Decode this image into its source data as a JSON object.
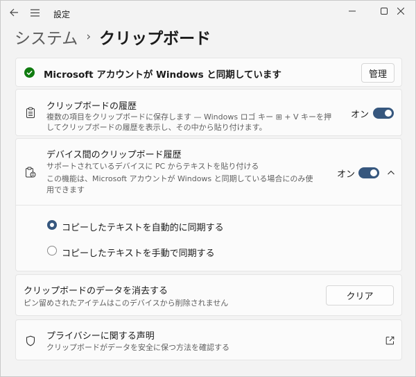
{
  "app": {
    "title": "設定",
    "back_icon": "arrow-left-icon",
    "menu_icon": "hamburger-icon"
  },
  "window_controls": {
    "minimize": "—",
    "maximize": "▢",
    "close": "✕"
  },
  "breadcrumb": {
    "parent": "システム",
    "separator": "›",
    "current": "クリップボード"
  },
  "sync_status": {
    "text": "Microsoft アカウントが Windows と同期しています",
    "button": "管理",
    "icon": "check-circle-icon",
    "icon_color": "#0f7b0f"
  },
  "history": {
    "title": "クリップボードの履歴",
    "description_line1": "複数の項目をクリップボードに保存します — Windows ロゴ キー ⊞ + V キーを押",
    "description_line2": "してクリップボードの履歴を表示し、その中から貼り付けます。",
    "toggle_label": "オン",
    "toggle_on": true,
    "icon": "clipboard-list-icon"
  },
  "cross_device": {
    "title": "デバイス間のクリップボード履歴",
    "description_line1": "サポートされているデバイスに PC からテキストを貼り付ける",
    "description_line2": "この機能は、Microsoft アカウントが Windows と同期している場合にのみ使",
    "description_line3": "用できます",
    "toggle_label": "オン",
    "toggle_on": true,
    "expanded": true,
    "icon": "clipboard-sync-icon",
    "options": [
      {
        "label": "コピーしたテキストを自動的に同期する",
        "selected": true
      },
      {
        "label": "コピーしたテキストを手動で同期する",
        "selected": false
      }
    ]
  },
  "clear": {
    "title": "クリップボードのデータを消去する",
    "description": "ピン留めされたアイテムはこのデバイスから削除されません",
    "button": "クリア"
  },
  "privacy": {
    "title": "プライバシーに関する声明",
    "description": "クリップボードがデータを安全に保つ方法を確認する",
    "icon": "shield-icon",
    "link_icon": "external-link-icon"
  },
  "colors": {
    "accent": "#36577e",
    "background": "#f3f3f3",
    "card": "#fbfbfb"
  }
}
